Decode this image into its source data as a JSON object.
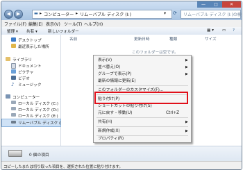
{
  "window": {
    "address": [
      "コンピューター",
      "リムーバブル ディスク (I:)"
    ],
    "search_placeholder": "リムーバブル ディスク (I:)の検索",
    "controls": [
      "—",
      "□",
      "✕"
    ]
  },
  "menubar": [
    "ファイル(F)",
    "編集(E)",
    "表示(V)",
    "ツール(T)",
    "ヘルプ(H)"
  ],
  "toolbar": {
    "organize": "整理 ▾",
    "share": "共有 ▾",
    "new_folder": "新しいフォルダー"
  },
  "nav": {
    "favorites": [
      "デスクトップ",
      "最近表示した場所"
    ],
    "libraries_header": "ライブラリ",
    "libraries": [
      "ドキュメント",
      "ピクチャ",
      "ビデオ",
      "ミュージック"
    ],
    "computer_header": "コンピューター",
    "drives": [
      "ローカル ディスク (C:)",
      "ローカル ディスク (D:)",
      "ローカル ディスク (E:)",
      "リムーバブル ディスク (I"
    ]
  },
  "columns": [
    "名前",
    "更新日時",
    "種類",
    "サイズ"
  ],
  "empty_message": "このフォルダーは空です。",
  "context_menu": {
    "items": [
      {
        "label": "表示(V)",
        "arrow": "▶"
      },
      {
        "label": "並べ替え(O)",
        "arrow": "▶"
      },
      {
        "label": "グループで表示(P)",
        "arrow": "▶"
      },
      {
        "label": "最新の情報に更新(E)"
      },
      {
        "label": "このフォルダーのカスタマイズ(F)..."
      },
      {
        "label": "貼り付け(P)"
      },
      {
        "label": "ショートカットの貼り付け(S)"
      },
      {
        "label": "元に戻す - 移動(U)",
        "shortcut": "Ctrl+Z"
      },
      {
        "label": "共有(H)",
        "arrow": "▶"
      },
      {
        "label": "新規作成(X)",
        "arrow": "▶"
      },
      {
        "label": "プロパティ(R)"
      }
    ]
  },
  "details": {
    "count": "0 個の項目"
  },
  "status": "コピーしたまたは切り取った項目を、選択された位置に貼り付けます。",
  "colors": {
    "highlight": "#e0101a",
    "titlebar": "#a9c4e2"
  }
}
